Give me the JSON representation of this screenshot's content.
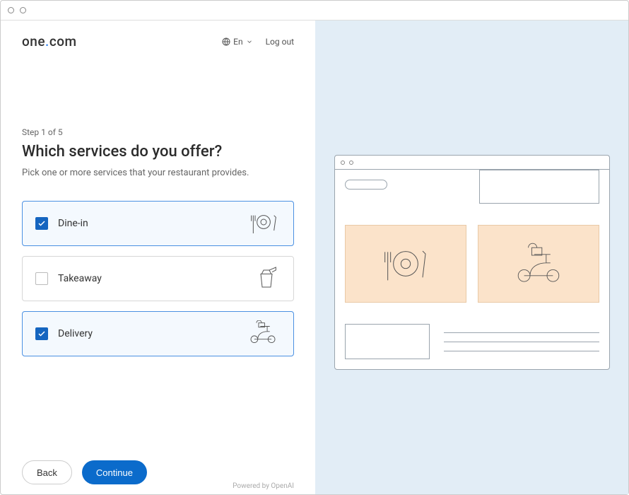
{
  "brand": {
    "name_part1": "one",
    "name_part2": "com"
  },
  "header": {
    "lang_label": "En",
    "logout_label": "Log out"
  },
  "step_label": "Step 1 of 5",
  "title": "Which services do you offer?",
  "subtitle": "Pick one or more services that your restaurant provides.",
  "options": [
    {
      "id": "dinein",
      "label": "Dine-in",
      "selected": true,
      "icon": "dinein-icon"
    },
    {
      "id": "takeaway",
      "label": "Takeaway",
      "selected": false,
      "icon": "takeaway-icon"
    },
    {
      "id": "delivery",
      "label": "Delivery",
      "selected": true,
      "icon": "delivery-icon"
    }
  ],
  "footer": {
    "back_label": "Back",
    "continue_label": "Continue"
  },
  "powered_label": "Powered by OpenAI"
}
